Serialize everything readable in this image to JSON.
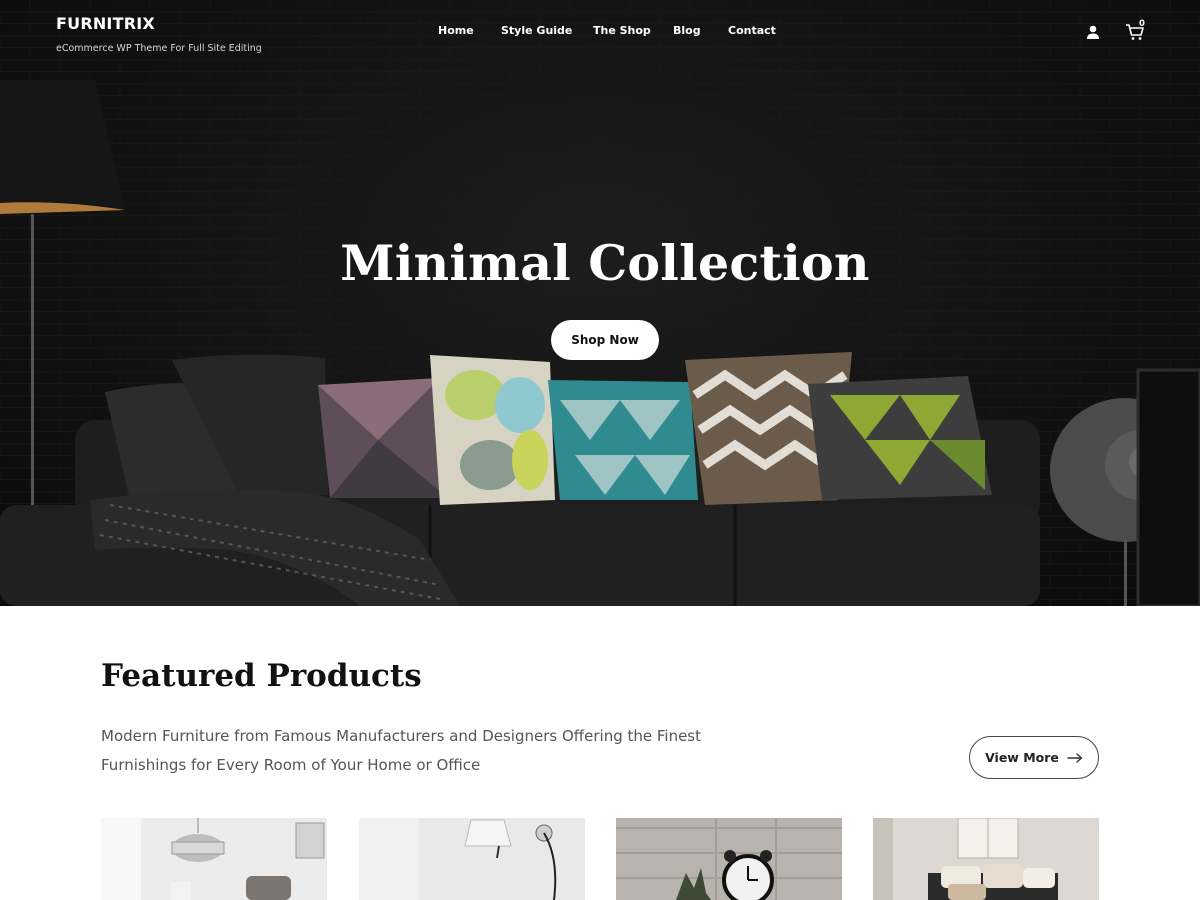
{
  "brand": {
    "name": "FURNITRIX",
    "tagline": "eCommerce WP Theme For Full Site Editing"
  },
  "nav": {
    "items": [
      "Home",
      "Style Guide",
      "The Shop",
      "Blog",
      "Contact"
    ]
  },
  "header": {
    "user_icon": "user-icon",
    "cart_icon": "cart-icon",
    "cart_count": "0"
  },
  "hero": {
    "title": "Minimal Collection",
    "cta_label": "Shop Now"
  },
  "featured": {
    "title": "Featured Products",
    "description": "Modern Furniture from Famous Manufacturers and Designers Offering the Finest Furnishings for Every Room of Your Home or Office",
    "view_more_label": "View More",
    "view_more_icon": "arrow-right-icon"
  },
  "colors": {
    "hero_bg": "#111111",
    "accent": "#ffffff",
    "text_dark": "#111111",
    "text_muted": "#555555"
  }
}
